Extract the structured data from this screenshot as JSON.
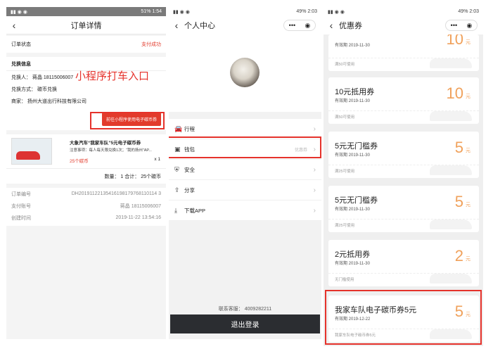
{
  "colors": {
    "accent_red": "#e23b2c",
    "amount_orange": "#f0a15b",
    "logout_bg": "#2b2d31"
  },
  "panel1": {
    "status_right": "51% 1:54",
    "title": "订单详情",
    "order_status_label": "订单状态",
    "order_status_value": "支付成功",
    "section_title": "兑换信息",
    "exchanger": "兑换人：   蒋晶 18115006007",
    "method": "兑换方式：   碳币兑换",
    "merchant": "商家：   扬州大道出行科技有限公司",
    "annotation": "小程序打车入口",
    "goto_button": "前往小程序使用电子碳币券",
    "product_title": "大象汽车“我家车队”5元电子碳币券",
    "product_note": "注意事项：每人每天限兑换1次；“我的扬州”AP...",
    "product_price": "25个碳币",
    "product_qty": "x 1",
    "summary": "数量：  1     合计：  25个碳币",
    "order_no_label": "订单编号",
    "order_no": "DH20191122135416198179768110114 3",
    "pay_account_label": "支付账号",
    "pay_account": "蒋晶 18115006007",
    "created_label": "创建时间",
    "created": "2019-11-22 13:54:16"
  },
  "panel2": {
    "status_right": "49% 2:03",
    "title": "个人中心",
    "menu": [
      {
        "icon": "car-icon",
        "label": "行程",
        "right": ""
      },
      {
        "icon": "wallet-icon",
        "label": "钱包",
        "right": "优惠券"
      },
      {
        "icon": "shield-icon",
        "label": "安全",
        "right": ""
      },
      {
        "icon": "share-icon",
        "label": "分享",
        "right": ""
      },
      {
        "icon": "download-icon",
        "label": "下载APP",
        "right": ""
      }
    ],
    "service": "联系客服：  4009282211",
    "logout": "退出登录"
  },
  "panel3": {
    "status_right": "49% 2:03",
    "title": "优惠券",
    "coupons": [
      {
        "title": "",
        "expire": "有效期 2019-11-30",
        "amount": "10",
        "unit": "元",
        "cond": "满50可使用"
      },
      {
        "title": "10元抵用券",
        "expire": "有效期 2019-11-30",
        "amount": "10",
        "unit": "元",
        "cond": "满50可使用"
      },
      {
        "title": "5元无门槛券",
        "expire": "有效期 2019-11-30",
        "amount": "5",
        "unit": "元",
        "cond": "满25可使用"
      },
      {
        "title": "5元无门槛券",
        "expire": "有效期 2019-11-30",
        "amount": "5",
        "unit": "元",
        "cond": "满25可使用"
      },
      {
        "title": "2元抵用券",
        "expire": "有效期 2019-11-30",
        "amount": "2",
        "unit": "元",
        "cond": "无门槛使用"
      },
      {
        "title": "我家车队电子碳币券5元",
        "expire": "有效期 2019-12-22",
        "amount": "5",
        "unit": "元",
        "cond": "我家车队电子碳币券5元"
      }
    ]
  }
}
